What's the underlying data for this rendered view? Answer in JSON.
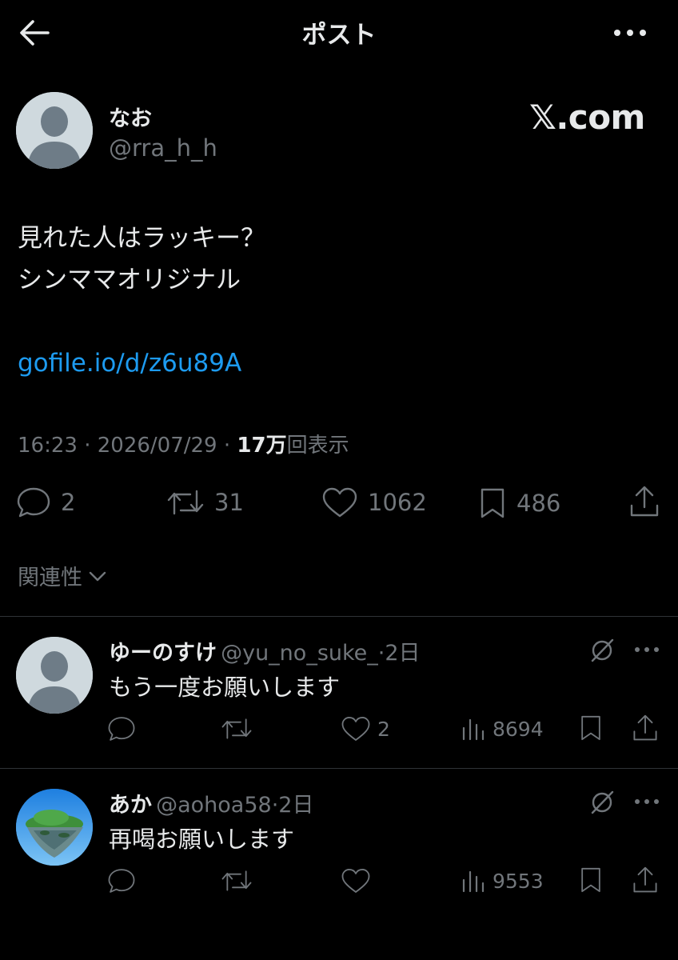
{
  "header": {
    "title": "ポスト"
  },
  "post": {
    "author_name": "なお",
    "author_handle": "@rra_h_h",
    "watermark": "𝕏.com",
    "text_line1": "見れた人はラッキー？",
    "text_line2": "シンママオリジナル",
    "link": "gofile.io/d/z6u89A",
    "time": "16:23",
    "date": "2026/07/29",
    "views": "17万",
    "views_label": "回表示",
    "separator": "·",
    "replies": "2",
    "reposts": "31",
    "likes": "1062",
    "bookmarks": "486"
  },
  "sort": {
    "label": "関連性"
  },
  "replies": [
    {
      "name": "ゆーのすけ",
      "handle": "@yu_no_suke_",
      "age": "2日",
      "text": "もう一度お願いします",
      "likes": "2",
      "views": "8694"
    },
    {
      "name": "あか",
      "handle": "@aohoa58",
      "age": "2日",
      "text": "再喝お願いします",
      "likes": "",
      "views": "9553"
    }
  ],
  "colors": {
    "background": "#000000",
    "text": "#e7e9ea",
    "muted": "#71767b",
    "link": "#1d9bf0",
    "divider": "#2f3336"
  }
}
